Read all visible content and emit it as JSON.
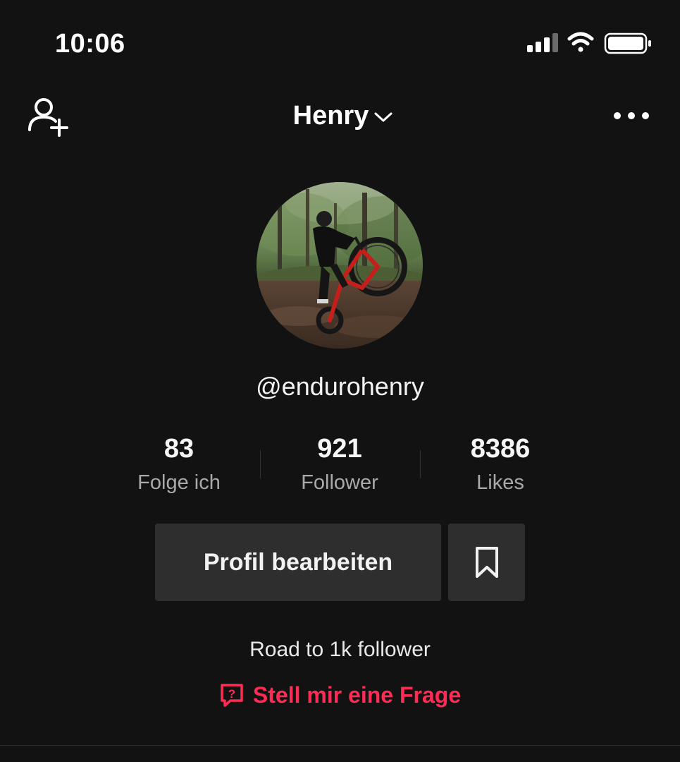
{
  "status_bar": {
    "time": "10:06",
    "icons": [
      "cellular-signal-icon",
      "wifi-icon",
      "battery-icon"
    ]
  },
  "header": {
    "title": "Henry",
    "left_icon": "add-friend-icon",
    "title_icon": "chevron-down-icon",
    "right_icon": "more-options-icon"
  },
  "profile": {
    "avatar": "profile-photo",
    "username": "@endurohenry",
    "stats": [
      {
        "value": "83",
        "label": "Folge ich"
      },
      {
        "value": "921",
        "label": "Follower"
      },
      {
        "value": "8386",
        "label": "Likes"
      }
    ],
    "edit_button_label": "Profil bearbeiten",
    "favorites_icon": "bookmark-icon",
    "bio": "Road to 1k follower",
    "qa_label": "Stell mir eine Frage",
    "qa_icon": "question-bubble-icon"
  },
  "colors": {
    "background": "#121212",
    "button_bg": "#2e2e2e",
    "accent": "#fe2c55",
    "secondary_text": "#a9a9a9"
  }
}
